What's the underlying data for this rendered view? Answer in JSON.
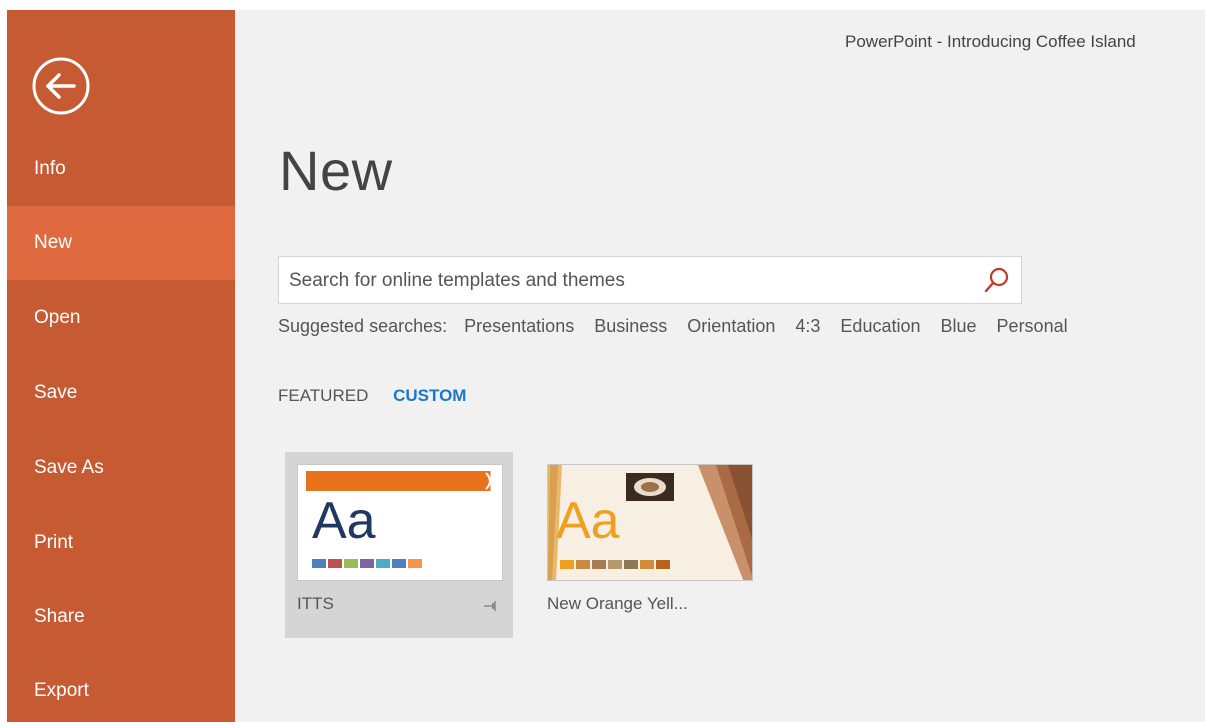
{
  "window": {
    "title": "PowerPoint - Introducing Coffee Island"
  },
  "sidebar": {
    "items": [
      {
        "label": "Info"
      },
      {
        "label": "New"
      },
      {
        "label": "Open"
      },
      {
        "label": "Save"
      },
      {
        "label": "Save As"
      },
      {
        "label": "Print"
      },
      {
        "label": "Share"
      },
      {
        "label": "Export"
      }
    ],
    "active_item": "New",
    "color": "#c55a33",
    "active_color": "#e06a40"
  },
  "main": {
    "title": "New",
    "search": {
      "placeholder": "Search for online templates and themes"
    },
    "suggested": {
      "label": "Suggested searches:",
      "items": [
        "Presentations",
        "Business",
        "Orientation",
        "4:3",
        "Education",
        "Blue",
        "Personal"
      ]
    },
    "tabs": [
      {
        "label": "FEATURED"
      },
      {
        "label": "CUSTOM"
      }
    ],
    "active_tab": "CUSTOM",
    "templates": [
      {
        "name": "ITTS",
        "thumb_text": "Aa",
        "accent": "#e8731c",
        "text_color": "#1f3864"
      },
      {
        "name": "New Orange Yell...",
        "thumb_text": "Aa",
        "accent": "#f0a020",
        "text_color": "#f0a020"
      }
    ]
  },
  "colors": {
    "link": "#1b78c8",
    "search_icon": "#c0392b"
  }
}
